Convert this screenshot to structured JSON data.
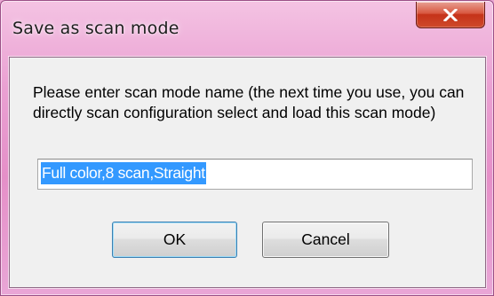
{
  "window": {
    "title": "Save as scan mode",
    "close_icon": "close-icon"
  },
  "dialog": {
    "prompt": "Please enter scan mode name (the next time you use, you can directly scan configuration select and load this scan mode)",
    "input_value": "Full color,8 scan,Straight",
    "ok_label": "OK",
    "cancel_label": "Cancel"
  },
  "colors": {
    "titlebar": "#e58fc8",
    "close_button": "#c53219",
    "selection": "#3399ff",
    "client_bg": "#f0f0f0"
  }
}
